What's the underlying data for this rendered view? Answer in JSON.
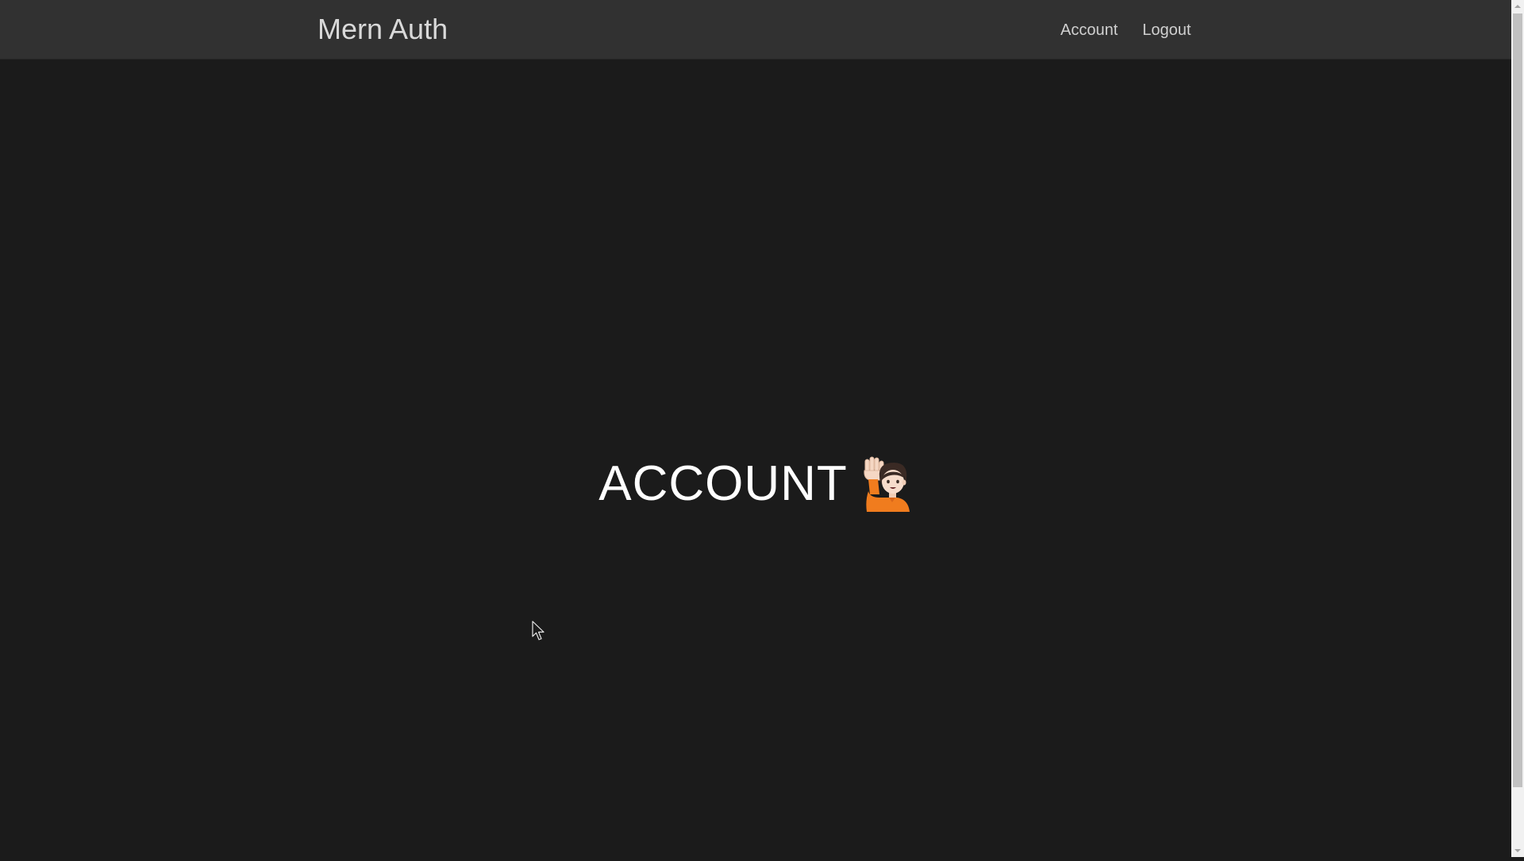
{
  "navbar": {
    "brand": "Mern Auth",
    "links": [
      {
        "label": "Account"
      },
      {
        "label": "Logout"
      }
    ]
  },
  "main": {
    "title": "ACCOUNT",
    "emoji_icon": "person-raising-hand-icon"
  },
  "colors": {
    "background": "#1b1b1b",
    "navbar": "#313131",
    "title_text": "#ffffff",
    "nav_text": "#d0d0d0",
    "emoji_shirt": "#f07c1e"
  }
}
